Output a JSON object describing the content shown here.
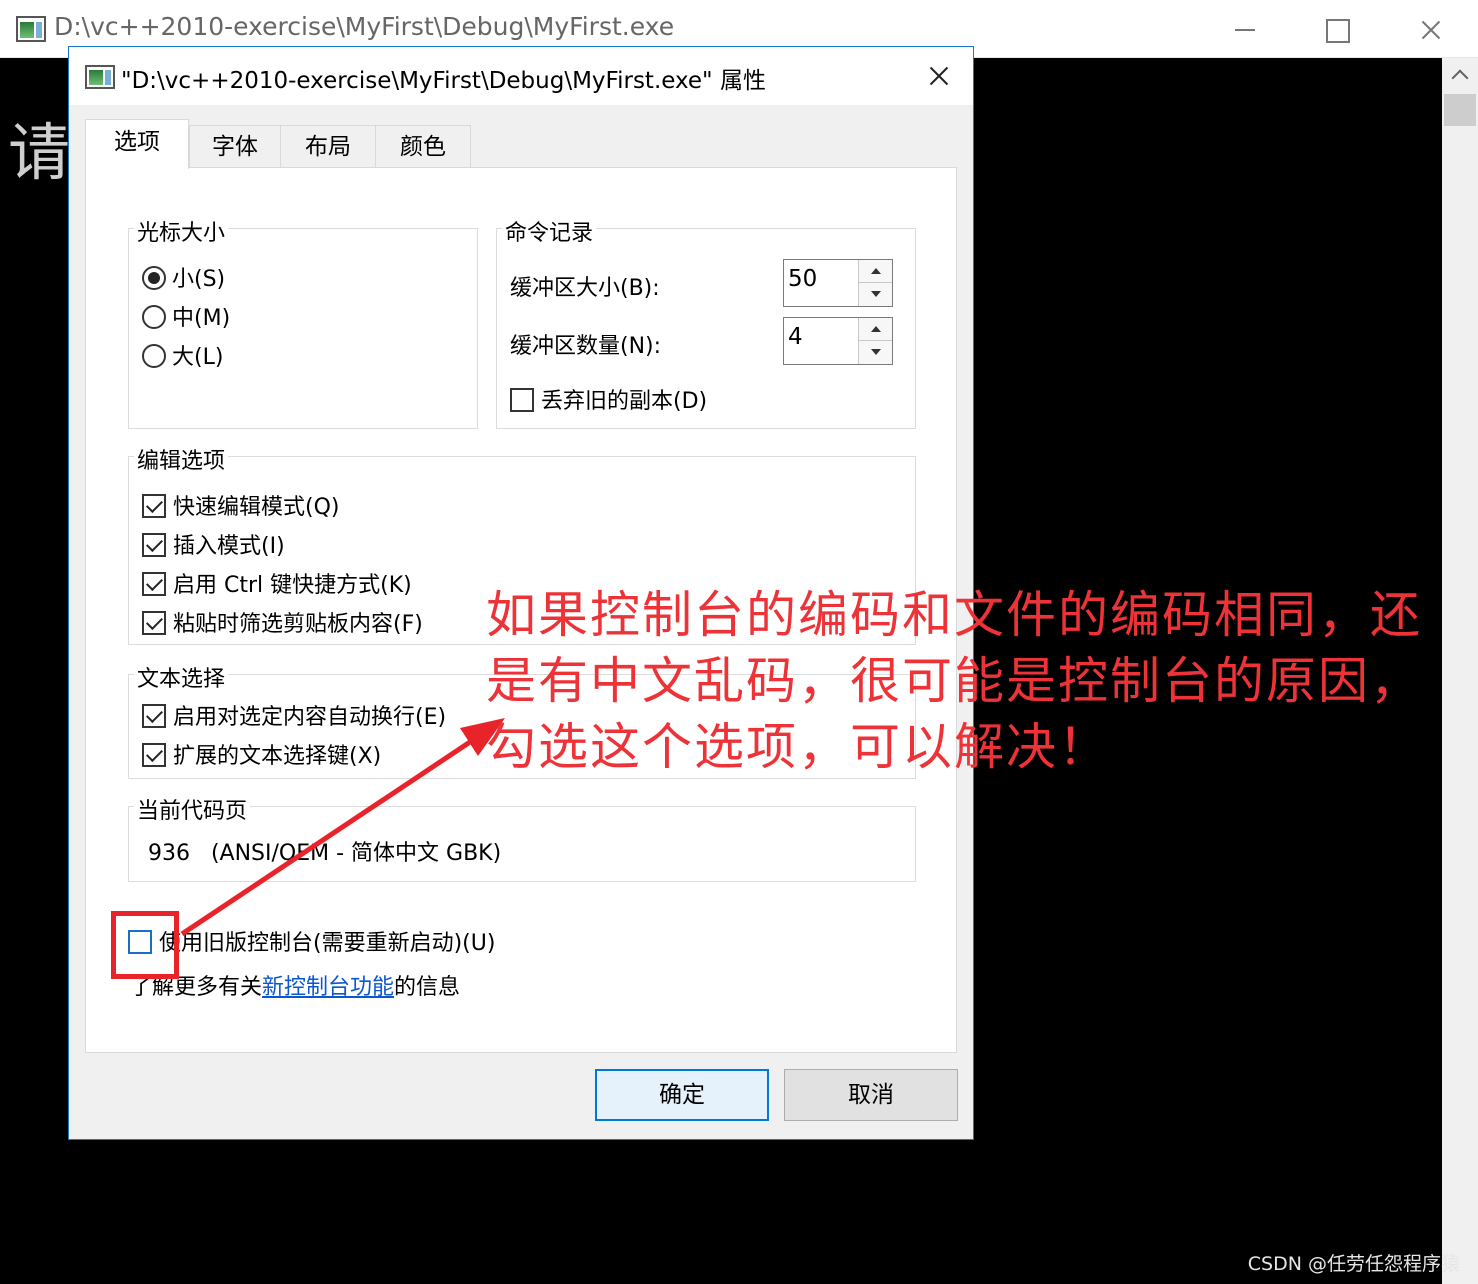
{
  "console": {
    "title": "D:\\vc++2010-exercise\\MyFirst\\Debug\\MyFirst.exe",
    "visible_char": "请",
    "icon": "console-window-icon"
  },
  "dialog": {
    "title": "\"D:\\vc++2010-exercise\\MyFirst\\Debug\\MyFirst.exe\" 属性",
    "tabs": [
      {
        "label": "选项",
        "active": true
      },
      {
        "label": "字体",
        "active": false
      },
      {
        "label": "布局",
        "active": false
      },
      {
        "label": "颜色",
        "active": false
      }
    ],
    "cursor_size": {
      "label": "光标大小",
      "options": [
        {
          "label": "小(S)",
          "checked": true
        },
        {
          "label": "中(M)",
          "checked": false
        },
        {
          "label": "大(L)",
          "checked": false
        }
      ]
    },
    "history": {
      "label": "命令记录",
      "buffer_size_label": "缓冲区大小(B):",
      "buffer_size_value": "50",
      "buffer_count_label": "缓冲区数量(N):",
      "buffer_count_value": "4",
      "discard_label": "丢弃旧的副本(D)",
      "discard_checked": false
    },
    "edit_options": {
      "label": "编辑选项",
      "items": [
        {
          "label": "快速编辑模式(Q)",
          "checked": true
        },
        {
          "label": "插入模式(I)",
          "checked": true
        },
        {
          "label": "启用 Ctrl 键快捷方式(K)",
          "checked": true
        },
        {
          "label": "粘贴时筛选剪贴板内容(F)",
          "checked": true
        }
      ]
    },
    "text_selection": {
      "label": "文本选择",
      "items": [
        {
          "label": "启用对选定内容自动换行(E)",
          "checked": true
        },
        {
          "label": "扩展的文本选择键(X)",
          "checked": true
        }
      ]
    },
    "codepage": {
      "label": "当前代码页",
      "value": "936   (ANSI/OEM - 简体中文 GBK)"
    },
    "legacy": {
      "label": "使用旧版控制台(需要重新启动)(U)",
      "checked": false
    },
    "more_info": {
      "prefix": "了解更多有关",
      "link": "新控制台功能",
      "suffix": "的信息"
    },
    "ok_label": "确定",
    "cancel_label": "取消"
  },
  "annotation": {
    "text": "如果控制台的编码和文件的编码相同，还是有中文乱码，很可能是控制台的原因，勾选这个选项，可以解决！",
    "color": "#ee3338"
  },
  "watermark": "CSDN @任劳任怨程序猿"
}
